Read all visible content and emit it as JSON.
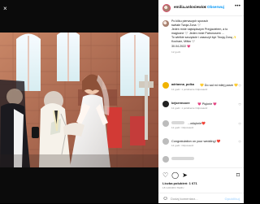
{
  "post": {
    "username": "emilia.anlosiewicz",
    "follow_label": "Obserwuj",
    "follow_separator": "•",
    "more_label": "•••",
    "caption": "Po kilku pierwszych sporach\nświtałe Twoja Żona 🤍\nJeden mnie największym Przyjacielem, a to\nmagiczne 🤍 Jeden mnie Patronusem ...\nTo wielkie szczęście i zaszczyt być Twoją Żoną ✨\nKocham, Miłka 🤍\n30.04.2022 💗",
    "caption_time": "12 godz.",
    "likes": "Liczba polubień: 1 671",
    "date": "18 GODZIN TEMU",
    "comment_placeholder": "Dodaj komentarz...",
    "post_button": "Opublikuj"
  },
  "comments": [
    {
      "user": "adrianna_polka",
      "text": "💛 Do sal mi miłej parze 💛",
      "meta": "12 godz.   1 polubienie   Odpowiedz"
    },
    {
      "user": "kejsermoore",
      "text": "💗 Pięknie 💗",
      "meta": "12 godz.   1 polubienie   Odpowiedz"
    },
    {
      "user": "",
      "text": "...ośięknie❤️",
      "meta": "12 godz.   Odpowiedz"
    },
    {
      "user": "",
      "text": "Congratulation on your wedding! ❤️",
      "meta": "12 godz.   Odpowiedz"
    },
    {
      "user": "",
      "text": "",
      "meta": ""
    }
  ],
  "icons": {
    "heart": "♡",
    "comment": "◯",
    "share": "➤",
    "bookmark": "⌑",
    "emoji": "☺",
    "close": "×"
  },
  "colors": {
    "accent": "#0095f6",
    "muted": "#8e8e8e"
  }
}
